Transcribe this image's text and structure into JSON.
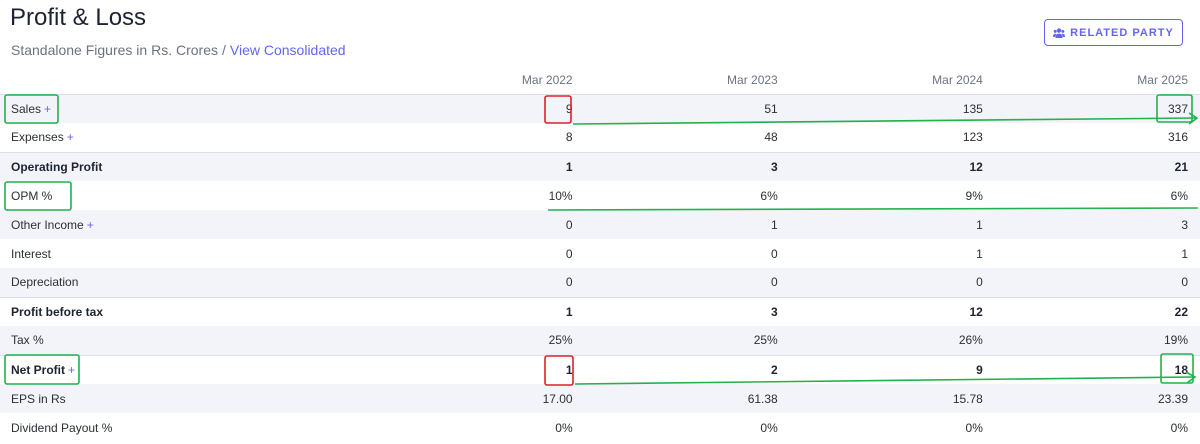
{
  "header": {
    "title": "Profit & Loss",
    "subtitle": "Standalone Figures in Rs. Crores",
    "separator": "/",
    "consolidated_link": "View Consolidated",
    "related_party_button": "RELATED PARTY"
  },
  "table": {
    "columns": [
      "Mar 2022",
      "Mar 2023",
      "Mar 2024",
      "Mar 2025"
    ],
    "rows": [
      {
        "label": "Sales",
        "expandable": "+",
        "values": [
          "9",
          "51",
          "135",
          "337"
        ]
      },
      {
        "label": "Expenses",
        "expandable": "+",
        "values": [
          "8",
          "48",
          "123",
          "316"
        ]
      },
      {
        "label": "Operating Profit",
        "values": [
          "1",
          "3",
          "12",
          "21"
        ]
      },
      {
        "label": "OPM %",
        "values": [
          "10%",
          "6%",
          "9%",
          "6%"
        ]
      },
      {
        "label": "Other Income",
        "expandable": "+",
        "values": [
          "0",
          "1",
          "1",
          "3"
        ]
      },
      {
        "label": "Interest",
        "values": [
          "0",
          "0",
          "1",
          "1"
        ]
      },
      {
        "label": "Depreciation",
        "values": [
          "0",
          "0",
          "0",
          "0"
        ]
      },
      {
        "label": "Profit before tax",
        "values": [
          "1",
          "3",
          "12",
          "22"
        ]
      },
      {
        "label": "Tax %",
        "values": [
          "25%",
          "25%",
          "26%",
          "19%"
        ]
      },
      {
        "label": "Net Profit",
        "expandable": "+",
        "values": [
          "1",
          "2",
          "9",
          "18"
        ]
      },
      {
        "label": "EPS in Rs",
        "values": [
          "17.00",
          "61.38",
          "15.78",
          "23.39"
        ]
      },
      {
        "label": "Dividend Payout %",
        "values": [
          "0%",
          "0%",
          "0%",
          "0%"
        ]
      }
    ]
  },
  "annotation_colors": {
    "green": "#22b14c",
    "red": "#e0202a"
  }
}
